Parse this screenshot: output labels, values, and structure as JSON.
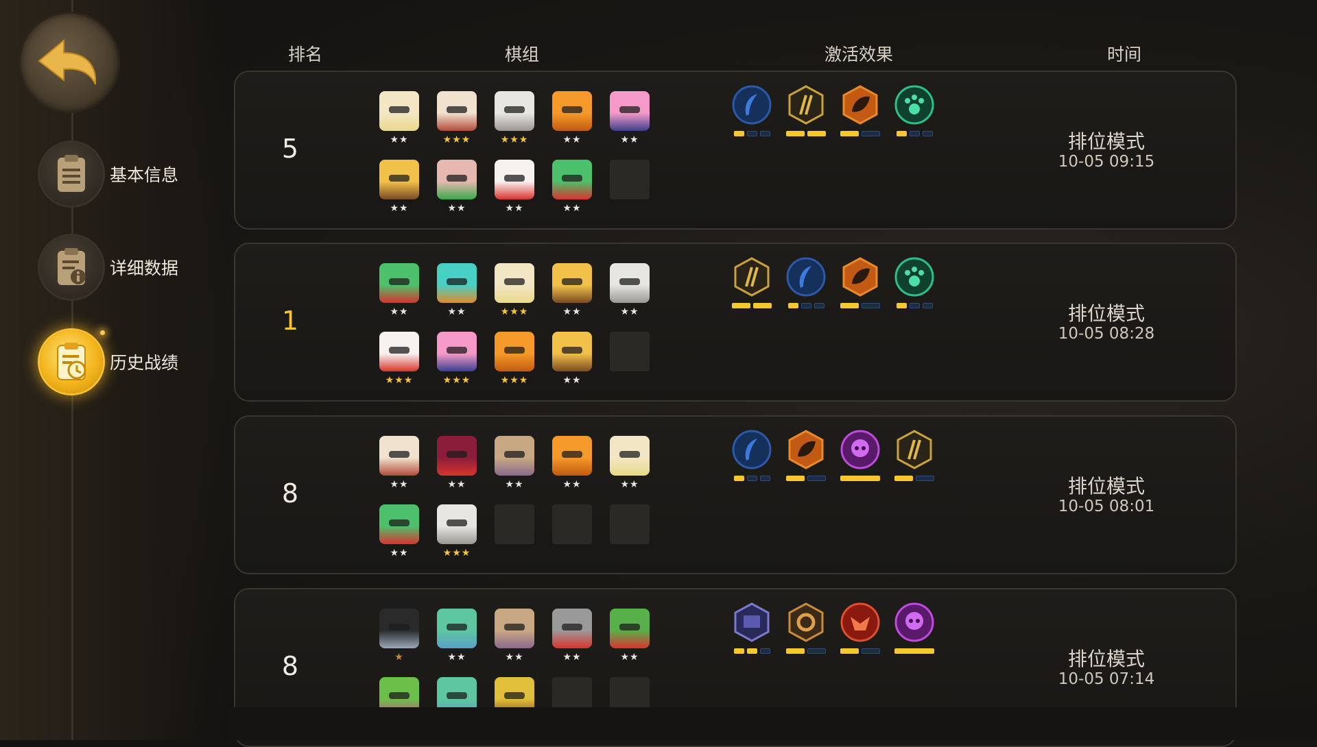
{
  "sidebar": {
    "back_icon": "back-arrow-icon",
    "items": [
      {
        "label": "基本信息",
        "icon": "document-icon",
        "active": false
      },
      {
        "label": "详细数据",
        "icon": "document-info-icon",
        "active": false
      },
      {
        "label": "历史战绩",
        "icon": "history-clock-icon",
        "active": true
      }
    ]
  },
  "headers": {
    "rank": "排名",
    "lineup": "棋组",
    "traits": "激活效果",
    "time": "时间"
  },
  "records": [
    {
      "rank": "5",
      "mode": "排位模式",
      "time": "10-05 09:15",
      "units": [
        {
          "name": "cowboy-pilot",
          "stars": 2
        },
        {
          "name": "cowboy-gunner",
          "stars": 3
        },
        {
          "name": "white-knight",
          "stars": 3
        },
        {
          "name": "flame-golem",
          "stars": 2
        },
        {
          "name": "pink-hair-bandit",
          "stars": 2
        },
        {
          "name": "hooded-horn",
          "stars": 2
        },
        {
          "name": "green-goblin",
          "stars": 2
        },
        {
          "name": "santa-warrior",
          "stars": 2
        },
        {
          "name": "green-frog",
          "stars": 2
        }
      ],
      "empty_slots": 1,
      "traits": [
        {
          "icon": "blue-feather-icon",
          "bars": [
            1,
            0,
            0
          ]
        },
        {
          "icon": "gold-claw-icon",
          "bars": [
            1,
            1
          ]
        },
        {
          "icon": "orange-leaf-icon",
          "bars": [
            1,
            0
          ]
        },
        {
          "icon": "green-paw-icon",
          "bars": [
            1,
            0,
            0
          ]
        }
      ]
    },
    {
      "rank": "1",
      "mode": "排位模式",
      "time": "10-05 08:28",
      "units": [
        {
          "name": "green-frog",
          "stars": 2
        },
        {
          "name": "teal-robot",
          "stars": 2
        },
        {
          "name": "cowboy-pilot",
          "stars": 3
        },
        {
          "name": "hooded-horn",
          "stars": 2
        },
        {
          "name": "white-knight",
          "stars": 2
        },
        {
          "name": "santa-warrior",
          "stars": 3
        },
        {
          "name": "pink-hair-bandit",
          "stars": 3
        },
        {
          "name": "flame-golem",
          "stars": 3
        },
        {
          "name": "hooded-horn",
          "stars": 2
        }
      ],
      "empty_slots": 1,
      "traits": [
        {
          "icon": "gold-claw-icon",
          "bars": [
            1,
            1
          ]
        },
        {
          "icon": "blue-feather-icon",
          "bars": [
            1,
            0,
            0
          ]
        },
        {
          "icon": "orange-leaf-icon",
          "bars": [
            1,
            0
          ]
        },
        {
          "icon": "green-paw-icon",
          "bars": [
            1,
            0,
            0
          ]
        }
      ]
    },
    {
      "rank": "8",
      "mode": "排位模式",
      "time": "10-05 08:01",
      "units": [
        {
          "name": "cowboy-gunner",
          "stars": 2
        },
        {
          "name": "red-demon",
          "stars": 2
        },
        {
          "name": "bandaged-mummy",
          "stars": 2
        },
        {
          "name": "flame-golem",
          "stars": 2
        },
        {
          "name": "cowboy-pilot",
          "stars": 2
        },
        {
          "name": "green-frog",
          "stars": 2
        },
        {
          "name": "white-knight",
          "stars": 3
        }
      ],
      "empty_slots": 3,
      "traits": [
        {
          "icon": "blue-feather-icon",
          "bars": [
            1,
            0,
            0
          ]
        },
        {
          "icon": "orange-leaf-icon",
          "bars": [
            1,
            0
          ]
        },
        {
          "icon": "purple-skull-icon",
          "bars": [
            1
          ]
        },
        {
          "icon": "gold-claw-icon",
          "bars": [
            1,
            0
          ]
        }
      ]
    },
    {
      "rank": "8",
      "mode": "排位模式",
      "time": "10-05 07:14",
      "units": [
        {
          "name": "dark-hood",
          "stars": 1
        },
        {
          "name": "green-alien-robot",
          "stars": 2
        },
        {
          "name": "bandaged-mummy",
          "stars": 2
        },
        {
          "name": "red-eye-skull",
          "stars": 2
        },
        {
          "name": "goblin-rider",
          "stars": 2
        },
        {
          "name": "tiki-mask",
          "stars": 0
        },
        {
          "name": "green-alien-robot",
          "stars": 0
        },
        {
          "name": "goggle-owl",
          "stars": 0
        }
      ],
      "empty_slots": 2,
      "traits": [
        {
          "icon": "purple-screen-icon",
          "bars": [
            1,
            1,
            0
          ]
        },
        {
          "icon": "bronze-gear-icon",
          "bars": [
            1,
            0
          ]
        },
        {
          "icon": "red-beast-icon",
          "bars": [
            1,
            0
          ]
        },
        {
          "icon": "purple-skull-icon",
          "bars": [
            1
          ]
        }
      ]
    }
  ],
  "colors": {
    "gold": "#f6c531",
    "card_bg": "#1c1a17",
    "bar_on": "#f7c72f",
    "bar_off": "#1b2c44"
  }
}
